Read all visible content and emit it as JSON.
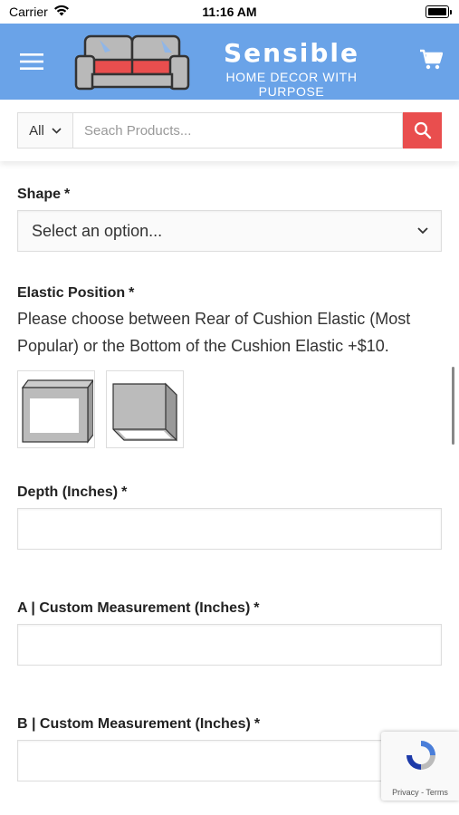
{
  "status": {
    "carrier": "Carrier",
    "time": "11:16 AM"
  },
  "header": {
    "brand_name": "Sensible",
    "tagline": "HOME DECOR WITH PURPOSE",
    "color": "#6aa3e8"
  },
  "search": {
    "category": "All",
    "placeholder": "Seach Products...",
    "button_color": "#e94e4e"
  },
  "form": {
    "shape": {
      "label": "Shape",
      "required": "*",
      "value": "Select an option..."
    },
    "elastic": {
      "label": "Elastic Position",
      "required": "*",
      "description": "Please choose between Rear of Cushion Elastic (Most Popular) or the Bottom of the Cushion Elastic +$10.",
      "options": [
        "rear-elastic-swatch",
        "bottom-elastic-swatch"
      ]
    },
    "depth": {
      "label": "Depth (Inches)",
      "required": "*"
    },
    "a_measure": {
      "label": "A | Custom Measurement (Inches)",
      "required": "*"
    },
    "b_measure": {
      "label": "B | Custom Measurement (Inches)",
      "required": "*"
    }
  },
  "recaptcha": {
    "links": "Privacy - Terms"
  }
}
